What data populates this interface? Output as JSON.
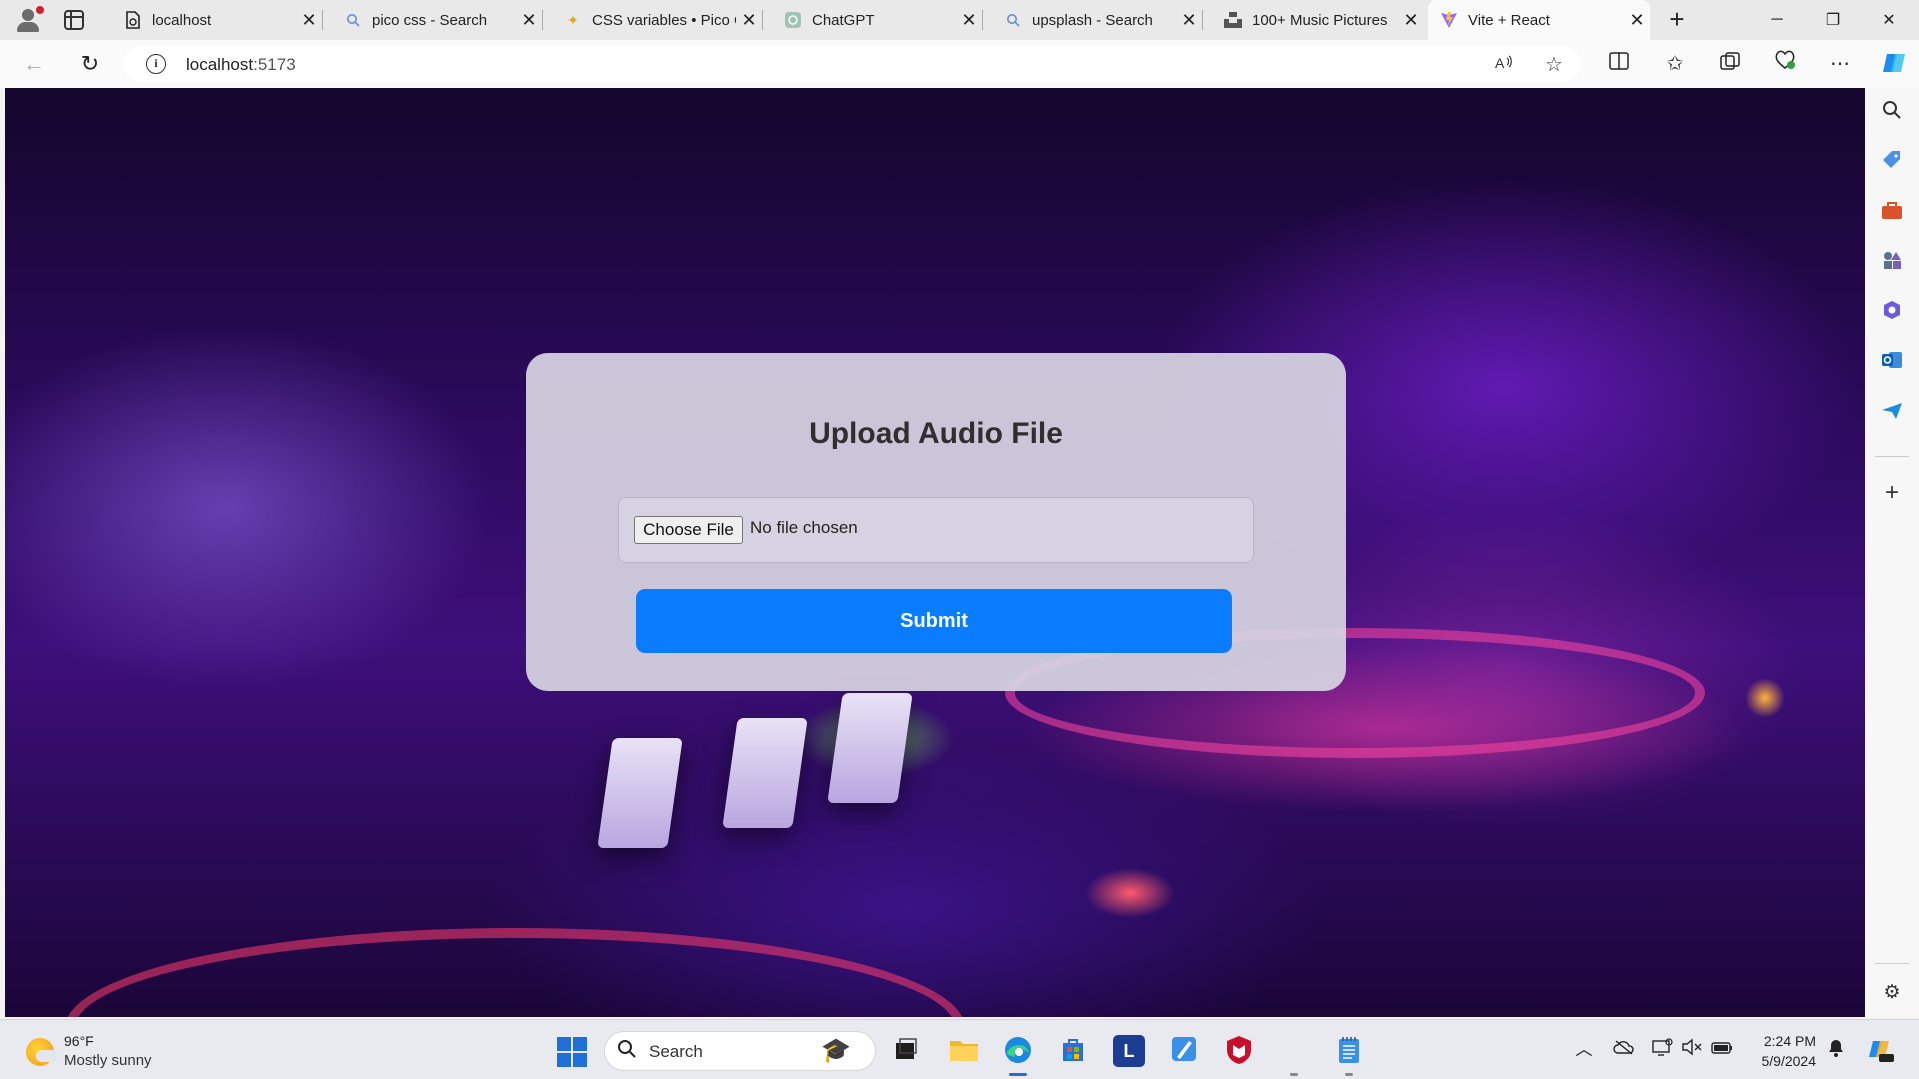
{
  "browser": {
    "tabs": [
      {
        "title": "localhost",
        "icon": "page-icon"
      },
      {
        "title": "pico css - Search",
        "icon": "search-icon"
      },
      {
        "title": "CSS variables • Pico CSS",
        "icon": "pico-icon"
      },
      {
        "title": "ChatGPT",
        "icon": "chatgpt-icon"
      },
      {
        "title": "upsplash - Search",
        "icon": "search-icon"
      },
      {
        "title": "100+ Music Pictures",
        "icon": "unsplash-icon"
      },
      {
        "title": "Vite + React",
        "icon": "vite-icon",
        "active": true
      }
    ],
    "address": {
      "host": "localhost",
      "port": ":5173"
    }
  },
  "page": {
    "title": "Upload Audio File",
    "choose_file_label": "Choose File",
    "no_file_text": "No file chosen",
    "submit_label": "Submit",
    "accent_color": "#0a7cff"
  },
  "taskbar": {
    "weather_temp": "96°F",
    "weather_desc": "Mostly sunny",
    "search_label": "Search",
    "time": "2:24 PM",
    "date": "5/9/2024"
  }
}
